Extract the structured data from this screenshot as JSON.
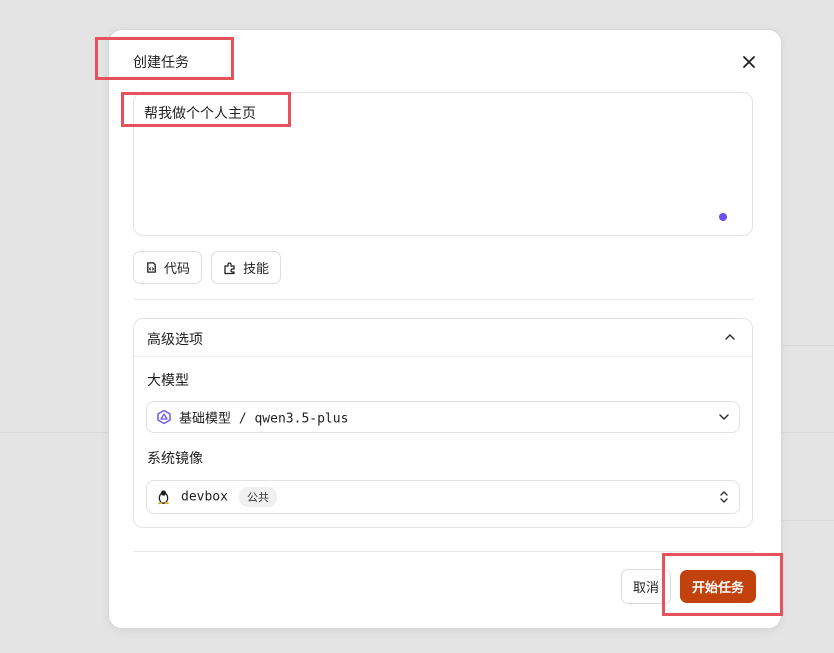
{
  "modal": {
    "title": "创建任务",
    "close_icon": "close-icon"
  },
  "prompt": {
    "value": "帮我做个个人主页"
  },
  "chips": {
    "code_label": "代码",
    "code_icon": "code-file-icon",
    "skill_label": "技能",
    "skill_icon": "puzzle-icon"
  },
  "advanced": {
    "title": "高级选项",
    "expanded": true,
    "model": {
      "label": "大模型",
      "value": "基础模型 / qwen3.5-plus",
      "icon": "qwen-logo-icon"
    },
    "image": {
      "label": "系统镜像",
      "value": "devbox",
      "badge": "公共",
      "icon": "linux-penguin-icon"
    }
  },
  "footer": {
    "cancel_label": "取消",
    "start_label": "开始任务"
  },
  "colors": {
    "primary": "#c2410c",
    "accent_dot": "#6d4ef0",
    "annotation": "#e5525c"
  }
}
